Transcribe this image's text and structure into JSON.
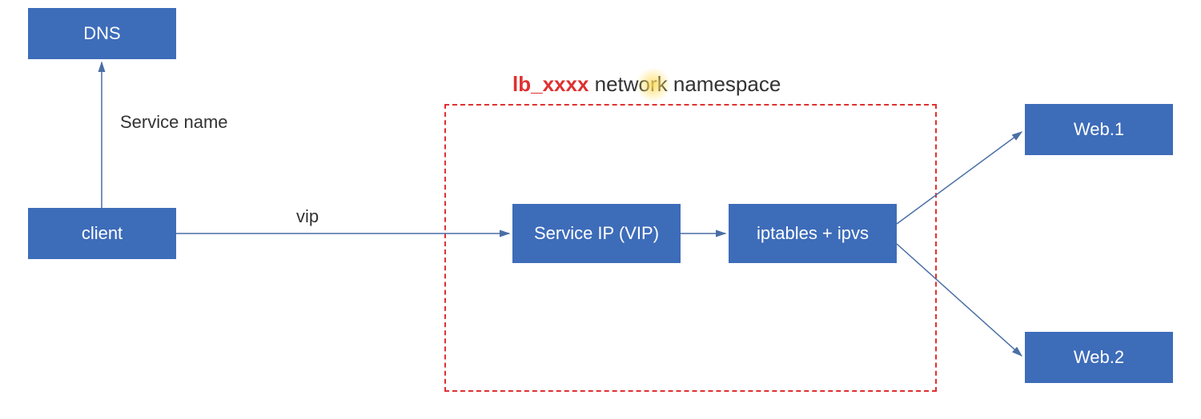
{
  "nodes": {
    "dns": {
      "label": "DNS"
    },
    "client": {
      "label": "client"
    },
    "vip_box": {
      "label": "Service IP (VIP)"
    },
    "iptables": {
      "label": "iptables + ipvs"
    },
    "web1": {
      "label": "Web.1"
    },
    "web2": {
      "label": "Web.2"
    }
  },
  "edges": {
    "client_to_dns": {
      "label": "Service name"
    },
    "client_to_vip": {
      "label": "vip"
    }
  },
  "namespace_title": {
    "accent": "lb_xxxx",
    "rest": " network namespace"
  },
  "colors": {
    "box_fill": "#3d6cb9",
    "box_text": "#ffffff",
    "accent_red": "#e03030",
    "line": "#4a6fa5"
  }
}
